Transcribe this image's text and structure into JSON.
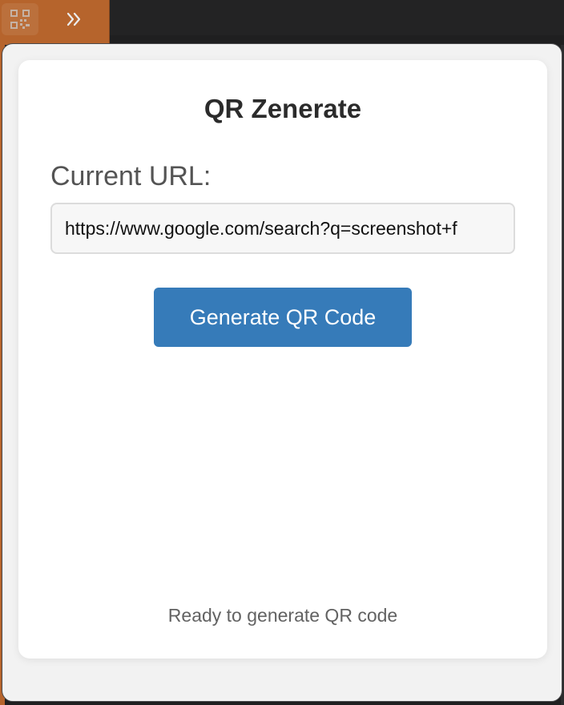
{
  "popup": {
    "title": "QR Zenerate",
    "url_label": "Current URL:",
    "url_value": "https://www.google.com/search?q=screenshot+f",
    "button_label": "Generate QR Code",
    "status": "Ready to generate QR code"
  },
  "toolbar": {
    "extension_icon": "qr-code-icon",
    "overflow_icon": "chevron-double-right-icon"
  },
  "colors": {
    "accent": "#367bb9",
    "extension_tile": "#b6642c",
    "title_text": "#2b2b2b",
    "status_text": "#626262"
  }
}
